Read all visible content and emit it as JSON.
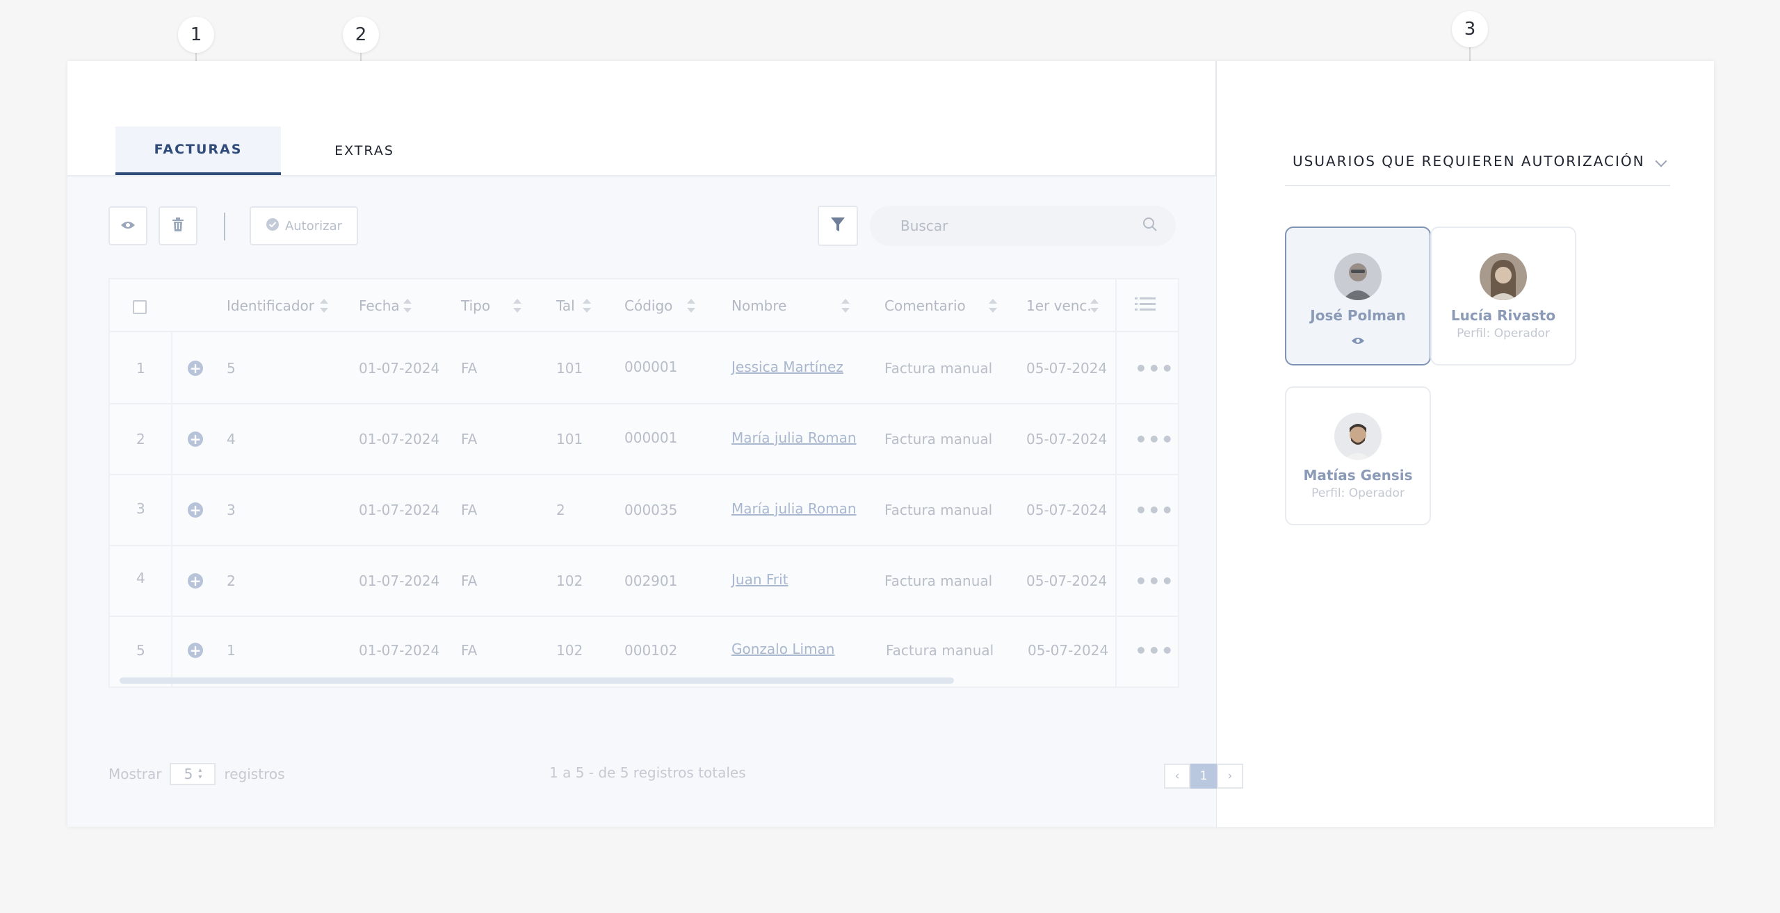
{
  "callouts": [
    "1",
    "2",
    "3"
  ],
  "tabs": {
    "facturas": "FACTURAS",
    "extras": "EXTRAS"
  },
  "toolbar": {
    "authorize_label": "Autorizar",
    "search_placeholder": "Buscar"
  },
  "table": {
    "columns": [
      "Identificador",
      "Fecha",
      "Tipo",
      "Tal",
      "Código",
      "Nombre",
      "Comentario",
      "1er venc."
    ],
    "rows": [
      {
        "n": "1",
        "id": "5",
        "fecha": "01-07-2024",
        "tipo": "FA",
        "tal": "101",
        "codigo": "000001",
        "nombre": "Jessica Martínez",
        "comentario": "Factura manual",
        "venc": "05-07-2024"
      },
      {
        "n": "2",
        "id": "4",
        "fecha": "01-07-2024",
        "tipo": "FA",
        "tal": "101",
        "codigo": "000001",
        "nombre": "María julia Roman",
        "comentario": "Factura manual",
        "venc": "05-07-2024"
      },
      {
        "n": "3",
        "id": "3",
        "fecha": "01-07-2024",
        "tipo": "FA",
        "tal": "2",
        "codigo": "000035",
        "nombre": "María julia Roman",
        "comentario": "Factura manual",
        "venc": "05-07-2024"
      },
      {
        "n": "4",
        "id": "2",
        "fecha": "01-07-2024",
        "tipo": "FA",
        "tal": "102",
        "codigo": "002901",
        "nombre": "Juan Frit",
        "comentario": "Factura manual",
        "venc": "05-07-2024"
      },
      {
        "n": "5",
        "id": "1",
        "fecha": "01-07-2024",
        "tipo": "FA",
        "tal": "102",
        "codigo": "000102",
        "nombre": "Gonzalo Liman",
        "comentario": "Factura manual",
        "venc": "05-07-2024"
      }
    ]
  },
  "footer": {
    "show": "Mostrar",
    "page_size": "5",
    "records": "registros",
    "summary": "1 a 5 - de 5 registros totales",
    "current_page": "1"
  },
  "right": {
    "title": "USUARIOS QUE REQUIEREN AUTORIZACIÓN",
    "users": [
      {
        "name": "José Polman",
        "profile": ""
      },
      {
        "name": "Lucía Rivasto",
        "profile": "Perfil: Operador"
      },
      {
        "name": "Matías Gensis",
        "profile": "Perfil: Operador"
      }
    ]
  }
}
